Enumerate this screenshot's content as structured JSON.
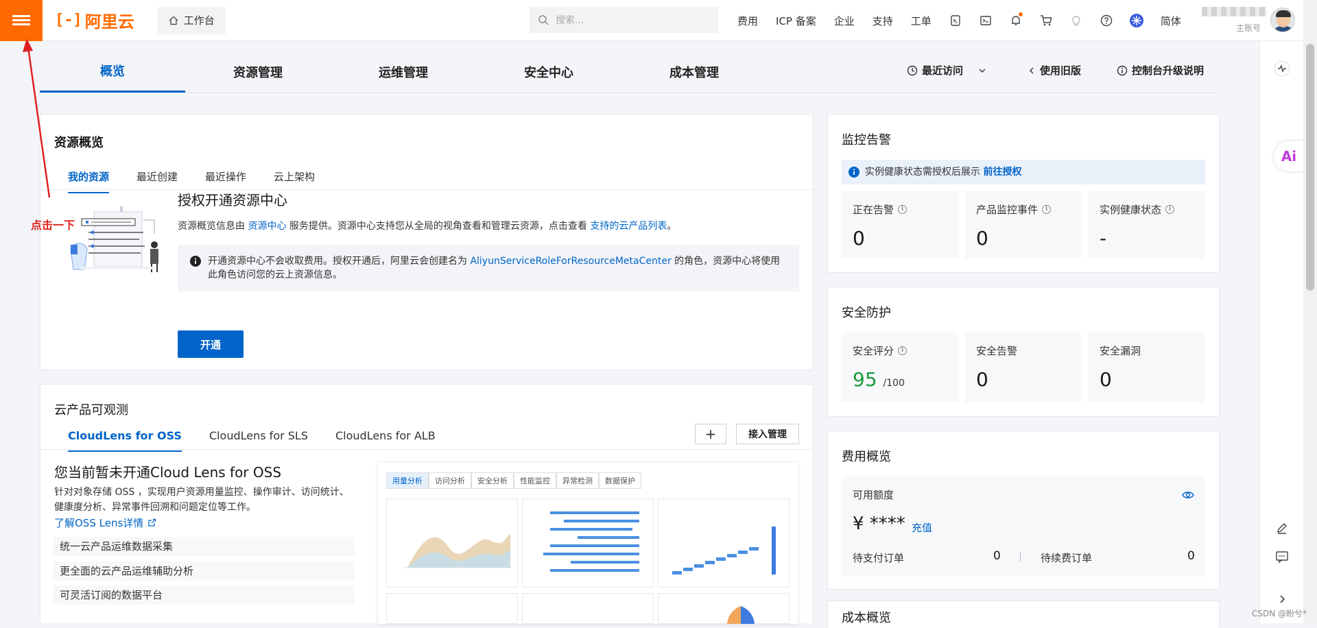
{
  "topbar": {
    "logo_text": "阿里云",
    "workbench_label": "工作台",
    "search_placeholder": "搜索...",
    "nav_items": [
      "费用",
      "ICP 备案",
      "企业",
      "支持",
      "工单"
    ],
    "lang": "简体",
    "account_sub": "主账号"
  },
  "main_tabs": [
    "概览",
    "资源管理",
    "运维管理",
    "安全中心",
    "成本管理"
  ],
  "right_tools": {
    "recent": "最近访问",
    "old_version": "使用旧版",
    "upgrade_note": "控制台升级说明"
  },
  "resource_overview": {
    "title": "资源概览",
    "tabs": [
      "我的资源",
      "最近创建",
      "最近操作",
      "云上架构"
    ],
    "heading": "授权开通资源中心",
    "desc_prefix": "资源概览信息由 ",
    "desc_link1": "资源中心",
    "desc_mid": " 服务提供。资源中心支持您从全局的视角查看和管理云资源，点击查看 ",
    "desc_link2": "支持的云产品列表",
    "desc_suffix": "。",
    "notice_prefix": "开通资源中心不会收取费用。授权开通后，阿里云会创建名为 ",
    "notice_role": "AliyunServiceRoleForResourceMetaCenter",
    "notice_suffix": " 的角色，资源中心将使用此角色访问您的云上资源信息。",
    "open_button": "开通"
  },
  "observability": {
    "title": "云产品可观测",
    "tabs": [
      "CloudLens for OSS",
      "CloudLens for SLS",
      "CloudLens for ALB"
    ],
    "manage_button": "接入管理",
    "heading": "您当前暂未开通Cloud Lens for OSS",
    "desc": "针对对象存储 OSS ，实现用户资源用量监控、操作审计、访问统计、健康度分析、异常事件回溯和问题定位等工作。",
    "learn_more": "了解OSS Lens详情",
    "features": [
      "统一云产品运维数据采集",
      "更全面的云产品运维辅助分析",
      "可灵活订阅的数据平台"
    ],
    "preview_tabs": [
      "用量分析",
      "访问分析",
      "安全分析",
      "性能监控",
      "异常检测",
      "数据保护"
    ]
  },
  "monitor": {
    "title": "监控告警",
    "notice": "实例健康状态需授权后展示 ",
    "notice_link": "前往授权",
    "stats": [
      {
        "label": "正在告警",
        "value": "0"
      },
      {
        "label": "产品监控事件",
        "value": "0"
      },
      {
        "label": "实例健康状态",
        "value": "-"
      }
    ]
  },
  "security": {
    "title": "安全防护",
    "score_label": "安全评分",
    "score": "95",
    "score_max": "/100",
    "alerts_label": "安全告警",
    "alerts": "0",
    "vuln_label": "安全漏洞",
    "vuln": "0"
  },
  "billing": {
    "title": "费用概览",
    "available_label": "可用额度",
    "amount": "¥ ****",
    "recharge": "充值",
    "pending_label": "待支付订单",
    "pending": "0",
    "renew_label": "待续费订单",
    "renew": "0"
  },
  "cost": {
    "title": "成本概览"
  },
  "annotation": "点击一下",
  "watermark": "CSDN @盼兮*"
}
